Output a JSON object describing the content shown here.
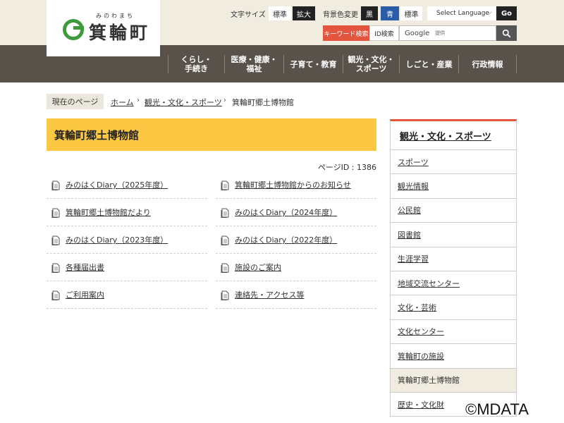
{
  "header": {
    "logo": {
      "name": "箕輪町",
      "ruby": "みのわまち"
    },
    "font_size": {
      "label": "文字サイズ",
      "standard": "標準",
      "large": "拡大"
    },
    "bg_color": {
      "label": "背景色変更",
      "black": "黒",
      "blue": "青",
      "standard": "標準"
    },
    "language": {
      "select": "Select Language",
      "go": "Go"
    },
    "search": {
      "tab_keyword": "キーワード検索",
      "tab_id": "ID検索",
      "google": "Google",
      "provided": "提供"
    },
    "colors": {
      "accent": "#e4553e",
      "nav_bg": "#58524a",
      "header_bg": "#f1ece0"
    }
  },
  "nav": [
    {
      "line1": "くらし・",
      "line2": "手続き"
    },
    {
      "line1": "医療・健康・",
      "line2": "福祉"
    },
    {
      "line1": "子育て・教育",
      "line2": ""
    },
    {
      "line1": "観光・文化・",
      "line2": "スポーツ"
    },
    {
      "line1": "しごと・産業",
      "line2": ""
    },
    {
      "line1": "行政情報",
      "line2": ""
    }
  ],
  "breadcrumb": {
    "current_label": "現在のページ",
    "items": [
      "ホーム",
      "観光・文化・スポーツ",
      "箕輪町郷土博物館"
    ]
  },
  "main": {
    "title": "箕輪町郷土博物館",
    "page_id": "ページID : 1386",
    "title_color": "#fcc843",
    "links": [
      "みのはくDiary（2025年度）",
      "箕輪町郷土博物館からのお知らせ",
      "箕輪町郷土博物館だより",
      "みのはくDiary（2024年度）",
      "みのはくDiary（2023年度）",
      "みのはくDiary（2022年度）",
      "各種届出書",
      "施設のご案内",
      "ご利用案内",
      "連絡先・アクセス等"
    ]
  },
  "sidebar": {
    "heading": "観光・文化・スポーツ",
    "items": [
      "スポーツ",
      "観光情報",
      "公民館",
      "図書館",
      "生涯学習",
      "地域交流センター",
      "文化・芸術",
      "文化センター",
      "箕輪町の施設",
      "箕輪町郷土博物館",
      "歴史・文化財"
    ],
    "current_index": 9
  },
  "watermark": "©MDATA"
}
